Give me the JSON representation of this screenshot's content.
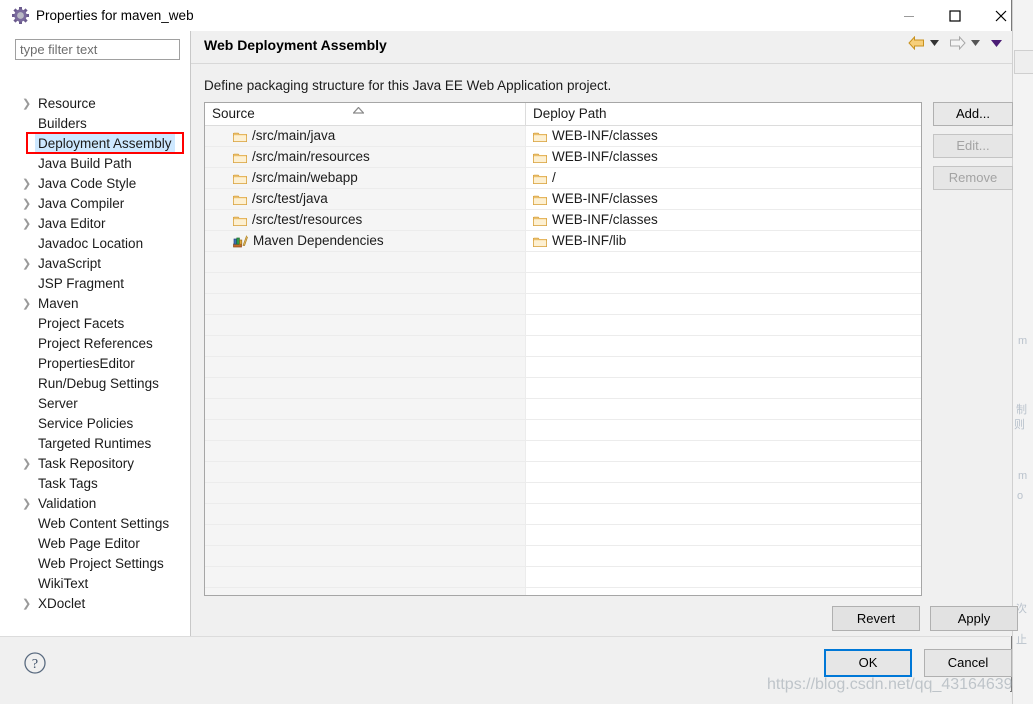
{
  "window": {
    "title": "Properties for maven_web",
    "icon": "properties-gear-icon",
    "minimize_label": "—",
    "maximize_label": "□",
    "close_label": "✕"
  },
  "sidebar": {
    "filter_placeholder": "type filter text",
    "filter_value": "",
    "items": [
      {
        "label": "Resource",
        "expandable": true,
        "selected": false
      },
      {
        "label": "Builders",
        "expandable": false,
        "selected": false
      },
      {
        "label": "Deployment Assembly",
        "expandable": false,
        "selected": true
      },
      {
        "label": "Java Build Path",
        "expandable": false,
        "selected": false
      },
      {
        "label": "Java Code Style",
        "expandable": true,
        "selected": false
      },
      {
        "label": "Java Compiler",
        "expandable": true,
        "selected": false
      },
      {
        "label": "Java Editor",
        "expandable": true,
        "selected": false
      },
      {
        "label": "Javadoc Location",
        "expandable": false,
        "selected": false
      },
      {
        "label": "JavaScript",
        "expandable": true,
        "selected": false
      },
      {
        "label": "JSP Fragment",
        "expandable": false,
        "selected": false
      },
      {
        "label": "Maven",
        "expandable": true,
        "selected": false
      },
      {
        "label": "Project Facets",
        "expandable": false,
        "selected": false
      },
      {
        "label": "Project References",
        "expandable": false,
        "selected": false
      },
      {
        "label": "PropertiesEditor",
        "expandable": false,
        "selected": false
      },
      {
        "label": "Run/Debug Settings",
        "expandable": false,
        "selected": false
      },
      {
        "label": "Server",
        "expandable": false,
        "selected": false
      },
      {
        "label": "Service Policies",
        "expandable": false,
        "selected": false
      },
      {
        "label": "Targeted Runtimes",
        "expandable": false,
        "selected": false
      },
      {
        "label": "Task Repository",
        "expandable": true,
        "selected": false
      },
      {
        "label": "Task Tags",
        "expandable": false,
        "selected": false
      },
      {
        "label": "Validation",
        "expandable": true,
        "selected": false
      },
      {
        "label": "Web Content Settings",
        "expandable": false,
        "selected": false
      },
      {
        "label": "Web Page Editor",
        "expandable": false,
        "selected": false
      },
      {
        "label": "Web Project Settings",
        "expandable": false,
        "selected": false
      },
      {
        "label": "WikiText",
        "expandable": false,
        "selected": false
      },
      {
        "label": "XDoclet",
        "expandable": true,
        "selected": false
      }
    ]
  },
  "page": {
    "title": "Web Deployment Assembly",
    "description": "Define packaging structure for this Java EE Web Application project.",
    "nav": {
      "back_icon": "back-arrow-icon",
      "back_menu_icon": "chevron-down-icon",
      "forward_icon": "forward-arrow-icon",
      "forward_menu_icon": "chevron-down-icon",
      "view_menu_icon": "view-menu-chevron-icon"
    }
  },
  "table": {
    "columns": [
      "Source",
      "Deploy Path"
    ],
    "sort_indicator": "▲",
    "sorted_column": "Source",
    "rows": [
      {
        "source": "/src/main/java",
        "source_icon": "folder-icon",
        "deploy": "WEB-INF/classes",
        "deploy_icon": "folder-icon"
      },
      {
        "source": "/src/main/resources",
        "source_icon": "folder-icon",
        "deploy": "WEB-INF/classes",
        "deploy_icon": "folder-icon"
      },
      {
        "source": "/src/main/webapp",
        "source_icon": "folder-icon",
        "deploy": "/",
        "deploy_icon": "folder-icon"
      },
      {
        "source": "/src/test/java",
        "source_icon": "folder-icon",
        "deploy": "WEB-INF/classes",
        "deploy_icon": "folder-icon"
      },
      {
        "source": "/src/test/resources",
        "source_icon": "folder-icon",
        "deploy": "WEB-INF/classes",
        "deploy_icon": "folder-icon"
      },
      {
        "source": "Maven Dependencies",
        "source_icon": "maven-dependencies-icon",
        "deploy": "WEB-INF/lib",
        "deploy_icon": "folder-icon"
      }
    ],
    "empty_row_count": 17
  },
  "buttons": {
    "add": {
      "label": "Add...",
      "enabled": true
    },
    "edit": {
      "label": "Edit...",
      "enabled": false
    },
    "remove": {
      "label": "Remove",
      "enabled": false
    },
    "revert": {
      "label": "Revert",
      "enabled": true
    },
    "apply": {
      "label": "Apply",
      "enabled": true
    },
    "ok": {
      "label": "OK",
      "enabled": true,
      "default": true
    },
    "cancel": {
      "label": "Cancel",
      "enabled": true
    },
    "help_icon": "help-question-icon"
  },
  "colors": {
    "selection": "#cde8ff",
    "highlight_box": "#ff0000",
    "default_button_border": "#0078d7",
    "folder_icon": "#f3bf6a",
    "back_arrow": "#e8a33d",
    "view_menu": "#4b1d75"
  },
  "watermark": "https://blog.csdn.net/qq_43164639",
  "background_text": [
    "m",
    "制",
    "则",
    "m",
    "o",
    "次",
    "止"
  ]
}
